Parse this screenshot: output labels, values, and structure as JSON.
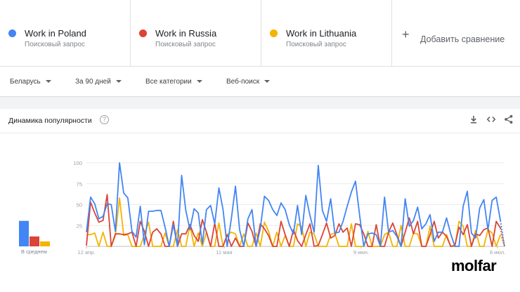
{
  "terms": [
    {
      "name": "Work in Poland",
      "sub": "Поисковый запрос",
      "color": "#4285f4"
    },
    {
      "name": "Work in Russia",
      "sub": "Поисковый запрос",
      "color": "#db4437"
    },
    {
      "name": "Work in Lithuania",
      "sub": "Поисковый запрос",
      "color": "#f4b400"
    }
  ],
  "add_compare": {
    "label": "Добавить сравнение",
    "icon": "plus-icon"
  },
  "filters": {
    "region": "Беларусь",
    "period": "За 90 дней",
    "category": "Все категории",
    "search_type": "Веб-поиск"
  },
  "card": {
    "title": "Динамика популярности",
    "help_icon": "?",
    "icons": [
      "download-icon",
      "embed-icon",
      "share-icon"
    ]
  },
  "average": {
    "label": "В среднем",
    "values": [
      36,
      14,
      7
    ]
  },
  "chart_data": {
    "type": "line",
    "title": "Динамика популярности",
    "ylim": [
      0,
      100
    ],
    "yticks": [
      25,
      50,
      75,
      100
    ],
    "xticks": [
      "12 апр.",
      "11 мая",
      "9 июн.",
      "8 июл."
    ],
    "grid": true,
    "x_start": "12 апр.",
    "series": [
      {
        "name": "Work in Poland",
        "color": "#4285f4",
        "values": [
          17,
          59,
          51,
          33,
          36,
          51,
          50,
          18,
          100,
          64,
          58,
          18,
          11,
          48,
          2,
          42,
          42,
          43,
          43,
          23,
          0,
          26,
          0,
          85,
          43,
          20,
          45,
          40,
          3,
          44,
          49,
          27,
          70,
          44,
          0,
          33,
          72,
          20,
          0,
          33,
          44,
          0,
          21,
          60,
          55,
          44,
          37,
          52,
          44,
          26,
          15,
          49,
          14,
          61,
          37,
          17,
          97,
          43,
          30,
          57,
          16,
          17,
          30,
          48,
          65,
          78,
          37,
          0,
          15,
          16,
          14,
          0,
          59,
          17,
          19,
          12,
          0,
          57,
          24,
          31,
          47,
          21,
          27,
          38,
          6,
          17,
          17,
          34,
          15,
          0,
          0,
          48,
          66,
          16,
          10,
          46,
          56,
          20,
          55,
          59,
          31,
          0
        ],
        "last_point_partial": true
      },
      {
        "name": "Work in Russia",
        "color": "#db4437",
        "values": [
          1,
          53,
          40,
          29,
          31,
          62,
          0,
          15,
          15,
          14,
          15,
          17,
          0,
          30,
          18,
          0,
          17,
          21,
          15,
          0,
          0,
          30,
          0,
          15,
          15,
          26,
          13,
          6,
          32,
          17,
          0,
          28,
          0,
          0,
          14,
          0,
          10,
          0,
          0,
          28,
          18,
          0,
          27,
          21,
          13,
          0,
          0,
          30,
          14,
          0,
          20,
          7,
          0,
          14,
          27,
          0,
          1,
          14,
          28,
          10,
          13,
          27,
          17,
          22,
          0,
          27,
          26,
          15,
          0,
          0,
          26,
          0,
          0,
          17,
          28,
          14,
          0,
          17,
          34,
          15,
          30,
          0,
          0,
          14,
          30,
          10,
          17,
          12,
          0,
          1,
          23,
          14,
          26,
          0,
          15,
          13,
          20,
          22,
          0,
          30,
          22,
          0
        ],
        "last_point_partial": true
      },
      {
        "name": "Work in Lithuania",
        "color": "#f4b400",
        "values": [
          14,
          14,
          16,
          0,
          17,
          0,
          0,
          13,
          58,
          13,
          14,
          0,
          0,
          0,
          14,
          29,
          0,
          0,
          0,
          16,
          0,
          0,
          20,
          0,
          0,
          26,
          0,
          16,
          0,
          17,
          0,
          0,
          28,
          0,
          14,
          17,
          15,
          0,
          15,
          0,
          0,
          16,
          0,
          29,
          18,
          0,
          17,
          0,
          13,
          0,
          0,
          27,
          23,
          0,
          17,
          15,
          0,
          0,
          0,
          14,
          16,
          0,
          0,
          0,
          27,
          0,
          0,
          0,
          18,
          0,
          0,
          0,
          14,
          17,
          0,
          0,
          25,
          0,
          0,
          16,
          15,
          0,
          0,
          24,
          0,
          0,
          0,
          14,
          0,
          0,
          30,
          24,
          0,
          0,
          19,
          0,
          0,
          20,
          16,
          0,
          14,
          0
        ],
        "last_point_partial": true
      }
    ]
  },
  "watermark": {
    "text": "molfar"
  }
}
